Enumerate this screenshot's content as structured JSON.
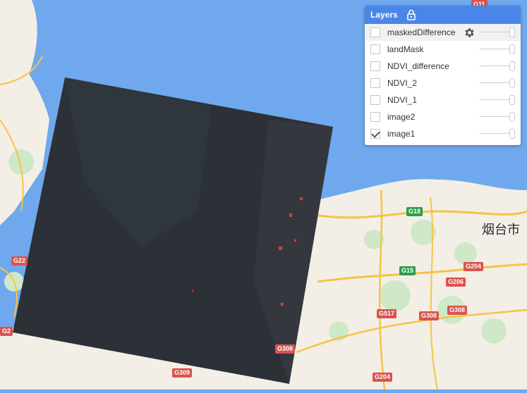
{
  "map": {
    "route_labels": [
      {
        "text": "G11",
        "kind": "g"
      },
      {
        "text": "G18",
        "kind": "e"
      },
      {
        "text": "G15",
        "kind": "e"
      },
      {
        "text": "G204",
        "kind": "g"
      },
      {
        "text": "G206",
        "kind": "g"
      },
      {
        "text": "G308",
        "kind": "g"
      },
      {
        "text": "G308",
        "kind": "g"
      },
      {
        "text": "G517",
        "kind": "g"
      },
      {
        "text": "G308",
        "kind": "g"
      },
      {
        "text": "G309",
        "kind": "g"
      },
      {
        "text": "G204",
        "kind": "g"
      },
      {
        "text": "G22",
        "kind": "g"
      },
      {
        "text": "G2",
        "kind": "g"
      }
    ],
    "city": "烟台市"
  },
  "layers_panel": {
    "title": "Layers",
    "lock_icon": "lock-open-icon",
    "items": [
      {
        "name": "maskedDifference",
        "checked": false
      },
      {
        "name": "landMask",
        "checked": false
      },
      {
        "name": "NDVI_difference",
        "checked": false
      },
      {
        "name": "NDVI_2",
        "checked": false
      },
      {
        "name": "NDVI_1",
        "checked": false
      },
      {
        "name": "image2",
        "checked": false
      },
      {
        "name": "image1",
        "checked": true
      }
    ]
  }
}
